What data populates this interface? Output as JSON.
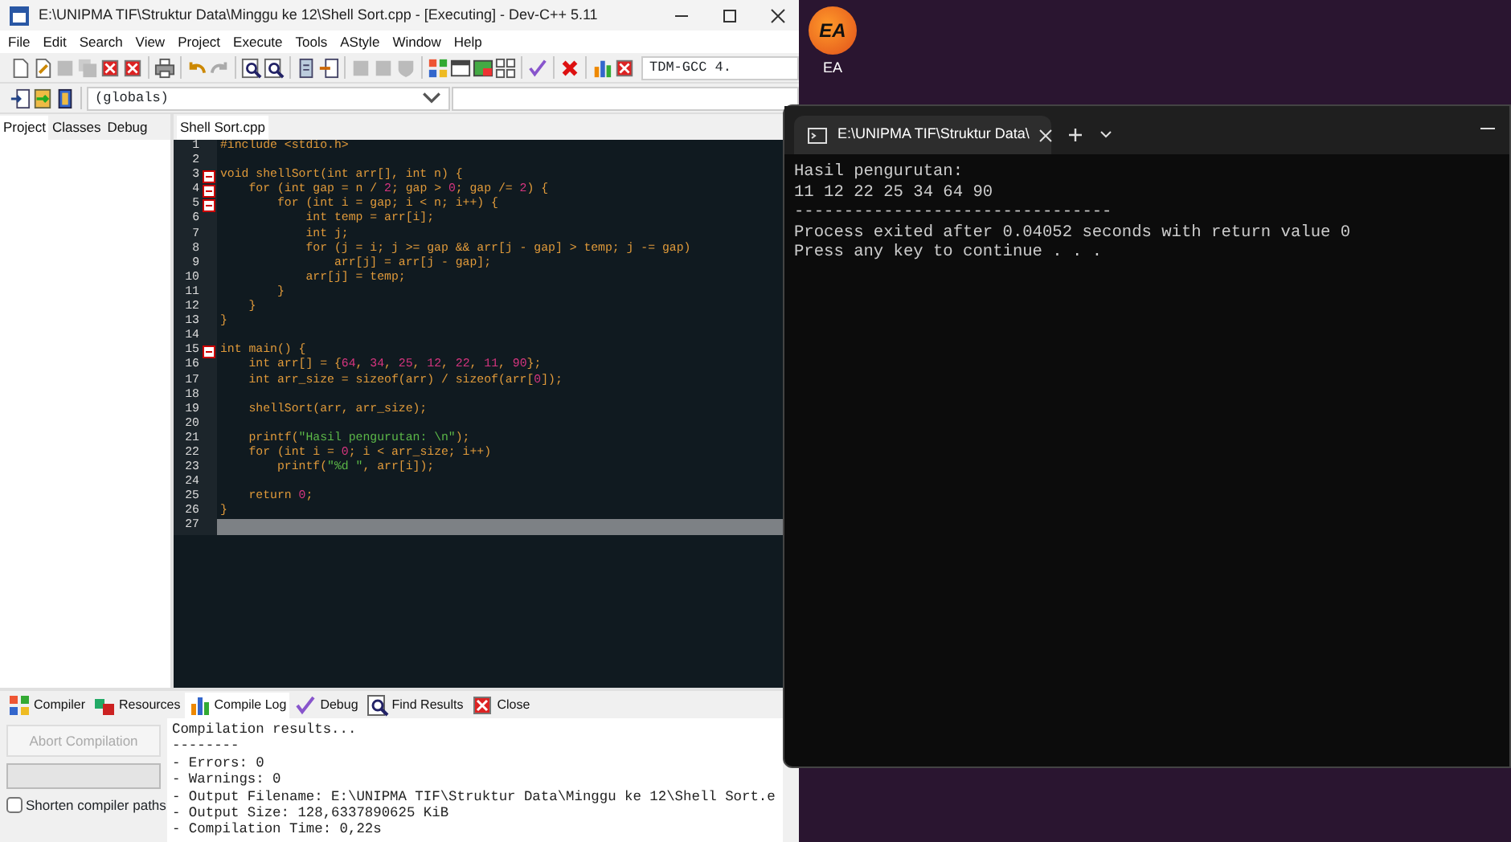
{
  "desktop_icons": [
    {
      "logo": "EA",
      "label": "EA"
    }
  ],
  "ide": {
    "title": "E:\\UNIPMA TIF\\Struktur Data\\Minggu ke 12\\Shell Sort.cpp - [Executing] - Dev-C++ 5.11",
    "menu": [
      "File",
      "Edit",
      "Search",
      "View",
      "Project",
      "Execute",
      "Tools",
      "AStyle",
      "Window",
      "Help"
    ],
    "compiler_select": "TDM-GCC 4.",
    "scope_select": "(globals)",
    "side_tabs": [
      {
        "label": "Project",
        "selected": true
      },
      {
        "label": "Classes",
        "selected": false
      },
      {
        "label": "Debug",
        "selected": false
      }
    ],
    "editor_tabs": [
      {
        "label": "Shell Sort.cpp",
        "selected": true
      }
    ],
    "code_lines": [
      {
        "number": "1",
        "fold": false,
        "current": false,
        "segments": [
          {
            "text": "#include <stdio.h>",
            "kind": "code"
          }
        ]
      },
      {
        "number": "2",
        "fold": false,
        "current": false
      },
      {
        "number": "3",
        "fold": true,
        "current": false,
        "segments": [
          {
            "text": "void shellSort(int arr[], int n) {",
            "kind": "code"
          }
        ]
      },
      {
        "number": "4",
        "fold": true,
        "current": false,
        "segments": [
          {
            "text": "    for (int gap = n / ",
            "kind": "code"
          },
          {
            "text": "2",
            "kind": "number"
          },
          {
            "text": "; gap > ",
            "kind": "code"
          },
          {
            "text": "0",
            "kind": "number"
          },
          {
            "text": "; gap /= ",
            "kind": "code"
          },
          {
            "text": "2",
            "kind": "number"
          },
          {
            "text": ") {",
            "kind": "code"
          }
        ]
      },
      {
        "number": "5",
        "fold": true,
        "current": false,
        "segments": [
          {
            "text": "        for (int i = gap; i < n; i++) {",
            "kind": "code"
          }
        ]
      },
      {
        "number": "6",
        "fold": false,
        "current": false,
        "segments": [
          {
            "text": "            int temp = arr[i];",
            "kind": "code"
          }
        ]
      },
      {
        "number": "7",
        "fold": false,
        "current": false,
        "segments": [
          {
            "text": "            int j;",
            "kind": "code"
          }
        ]
      },
      {
        "number": "8",
        "fold": false,
        "current": false,
        "segments": [
          {
            "text": "            for (j = i; j >= gap && arr[j - gap] > temp; j -= gap)",
            "kind": "code"
          }
        ]
      },
      {
        "number": "9",
        "fold": false,
        "current": false,
        "segments": [
          {
            "text": "                arr[j] = arr[j - gap];",
            "kind": "code"
          }
        ]
      },
      {
        "number": "10",
        "fold": false,
        "current": false,
        "segments": [
          {
            "text": "            arr[j] = temp;",
            "kind": "code"
          }
        ]
      },
      {
        "number": "11",
        "fold": false,
        "current": false,
        "segments": [
          {
            "text": "        }",
            "kind": "code"
          }
        ]
      },
      {
        "number": "12",
        "fold": false,
        "current": false,
        "segments": [
          {
            "text": "    }",
            "kind": "code"
          }
        ]
      },
      {
        "number": "13",
        "fold": false,
        "current": false,
        "segments": [
          {
            "text": "}",
            "kind": "code"
          }
        ]
      },
      {
        "number": "14",
        "fold": false,
        "current": false
      },
      {
        "number": "15",
        "fold": true,
        "current": false,
        "segments": [
          {
            "text": "int main() {",
            "kind": "code"
          }
        ]
      },
      {
        "number": "16",
        "fold": false,
        "current": false,
        "segments": [
          {
            "text": "    int arr[] = {",
            "kind": "code"
          },
          {
            "text": "64",
            "kind": "number"
          },
          {
            "text": ", ",
            "kind": "code"
          },
          {
            "text": "34",
            "kind": "number"
          },
          {
            "text": ", ",
            "kind": "code"
          },
          {
            "text": "25",
            "kind": "number"
          },
          {
            "text": ", ",
            "kind": "code"
          },
          {
            "text": "12",
            "kind": "number"
          },
          {
            "text": ", ",
            "kind": "code"
          },
          {
            "text": "22",
            "kind": "number"
          },
          {
            "text": ", ",
            "kind": "code"
          },
          {
            "text": "11",
            "kind": "number"
          },
          {
            "text": ", ",
            "kind": "code"
          },
          {
            "text": "90",
            "kind": "number"
          },
          {
            "text": "};",
            "kind": "code"
          }
        ]
      },
      {
        "number": "17",
        "fold": false,
        "current": false,
        "segments": [
          {
            "text": "    int arr_size = sizeof(arr) / sizeof(arr[",
            "kind": "code"
          },
          {
            "text": "0",
            "kind": "number"
          },
          {
            "text": "]);",
            "kind": "code"
          }
        ]
      },
      {
        "number": "18",
        "fold": false,
        "current": false
      },
      {
        "number": "19",
        "fold": false,
        "current": false,
        "segments": [
          {
            "text": "    shellSort(arr, arr_size);",
            "kind": "code"
          }
        ]
      },
      {
        "number": "20",
        "fold": false,
        "current": false
      },
      {
        "number": "21",
        "fold": false,
        "current": false,
        "segments": [
          {
            "text": "    printf(",
            "kind": "code"
          },
          {
            "text": "\"Hasil pengurutan: \\n\"",
            "kind": "string"
          },
          {
            "text": ");",
            "kind": "code"
          }
        ]
      },
      {
        "number": "22",
        "fold": false,
        "current": false,
        "segments": [
          {
            "text": "    for (int i = ",
            "kind": "code"
          },
          {
            "text": "0",
            "kind": "number"
          },
          {
            "text": "; i < arr_size; i++)",
            "kind": "code"
          }
        ]
      },
      {
        "number": "23",
        "fold": false,
        "current": false,
        "segments": [
          {
            "text": "        printf(",
            "kind": "code"
          },
          {
            "text": "\"%d \"",
            "kind": "string"
          },
          {
            "text": ", arr[i]);",
            "kind": "code"
          }
        ]
      },
      {
        "number": "24",
        "fold": false,
        "current": false
      },
      {
        "number": "25",
        "fold": false,
        "current": false,
        "segments": [
          {
            "text": "    return ",
            "kind": "code"
          },
          {
            "text": "0",
            "kind": "number"
          },
          {
            "text": ";",
            "kind": "code"
          }
        ]
      },
      {
        "number": "26",
        "fold": false,
        "current": false,
        "segments": [
          {
            "text": "}",
            "kind": "code"
          }
        ]
      },
      {
        "number": "27",
        "fold": false,
        "current": true
      }
    ],
    "bottom_tabs": [
      {
        "label": "Compiler",
        "selected": false
      },
      {
        "label": "Resources",
        "selected": false
      },
      {
        "label": "Compile Log",
        "selected": true
      },
      {
        "label": "Debug",
        "selected": false
      },
      {
        "label": "Find Results",
        "selected": false
      },
      {
        "label": "Close",
        "selected": false
      }
    ],
    "compile_progress": {
      "level": 0
    },
    "abort_button": {
      "label": "Abort Compilation",
      "disabled": true
    },
    "shorten_paths": {
      "label": "Shorten compiler paths",
      "checked": false
    },
    "log_lines": [
      "Compilation results...",
      "--------",
      "- Errors: 0",
      "- Warnings: 0",
      "- Output Filename: E:\\UNIPMA TIF\\Struktur Data\\Minggu ke 12\\Shell Sort.e",
      "- Output Size: 128,6337890625 KiB",
      "- Compilation Time: 0,22s"
    ]
  },
  "console": {
    "tab_title": "E:\\UNIPMA TIF\\Struktur Data\\",
    "lines": [
      "Hasil pengurutan:",
      "11 12 22 25 34 64 90",
      "--------------------------------",
      "Process exited after 0.04052 seconds with return value 0",
      "Press any key to continue . . ."
    ]
  }
}
